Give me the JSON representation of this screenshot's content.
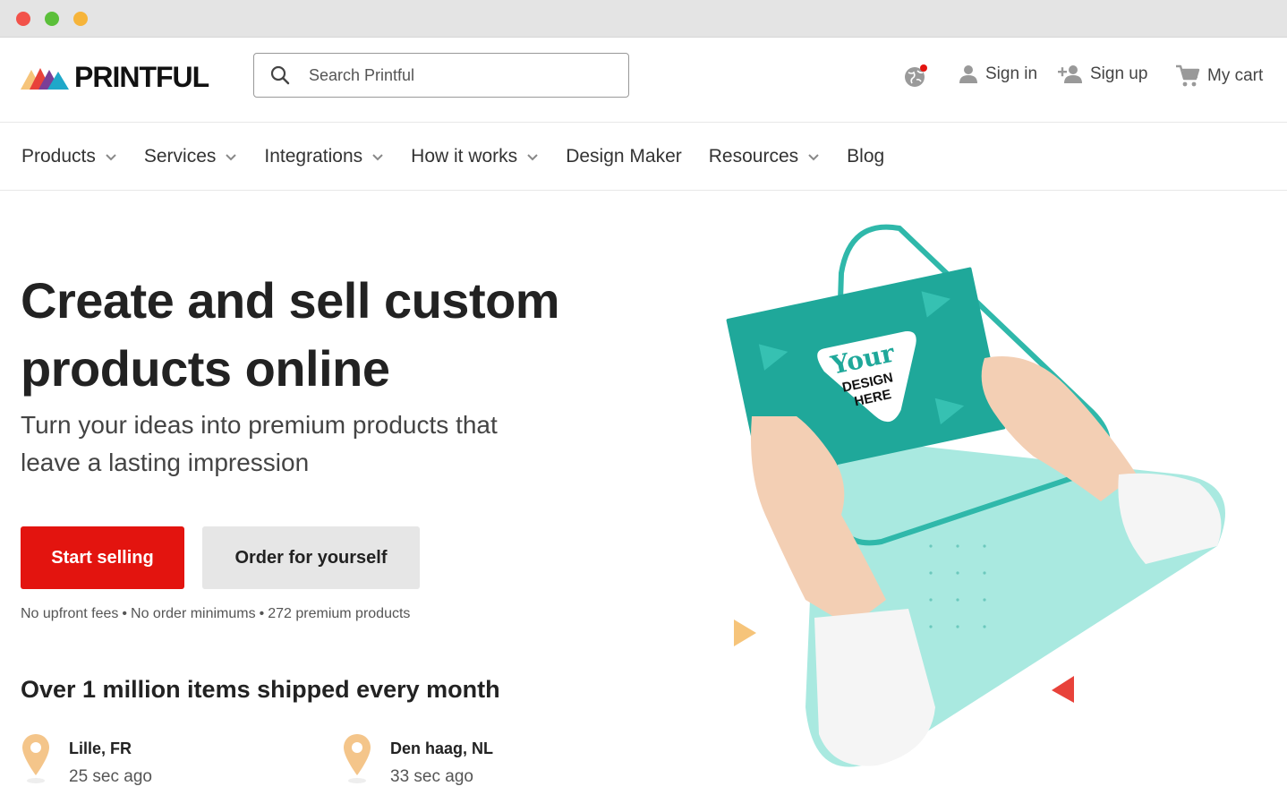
{
  "header": {
    "logo_text": "PRINTFUL",
    "search_placeholder": "Search Printful",
    "sign_in": "Sign in",
    "sign_up": "Sign up",
    "cart": "My cart"
  },
  "nav": {
    "items": [
      {
        "label": "Products",
        "dropdown": true
      },
      {
        "label": "Services",
        "dropdown": true
      },
      {
        "label": "Integrations",
        "dropdown": true
      },
      {
        "label": "How it works",
        "dropdown": true
      },
      {
        "label": "Design Maker",
        "dropdown": false
      },
      {
        "label": "Resources",
        "dropdown": true
      },
      {
        "label": "Blog",
        "dropdown": false
      }
    ]
  },
  "hero": {
    "title": "Create and sell custom products online",
    "subtitle": "Turn your ideas into premium products that leave a lasting impression",
    "primary_button": "Start selling",
    "secondary_button": "Order for yourself",
    "perks": [
      "No upfront fees",
      "No order minimums",
      "272 premium products"
    ],
    "card_text_1": "Your",
    "card_text_2": "DESIGN",
    "card_text_3": "HERE"
  },
  "shipping": {
    "title": "Over 1 million items shipped every month",
    "locations": [
      {
        "city": "Lille, FR",
        "time": "25 sec ago"
      },
      {
        "city": "Den haag, NL",
        "time": "33 sec ago"
      }
    ]
  },
  "colors": {
    "brand_red": "#e3140f",
    "teal": "#1fa89a",
    "mint": "#a9e9e0",
    "pin": "#f4c58a"
  }
}
